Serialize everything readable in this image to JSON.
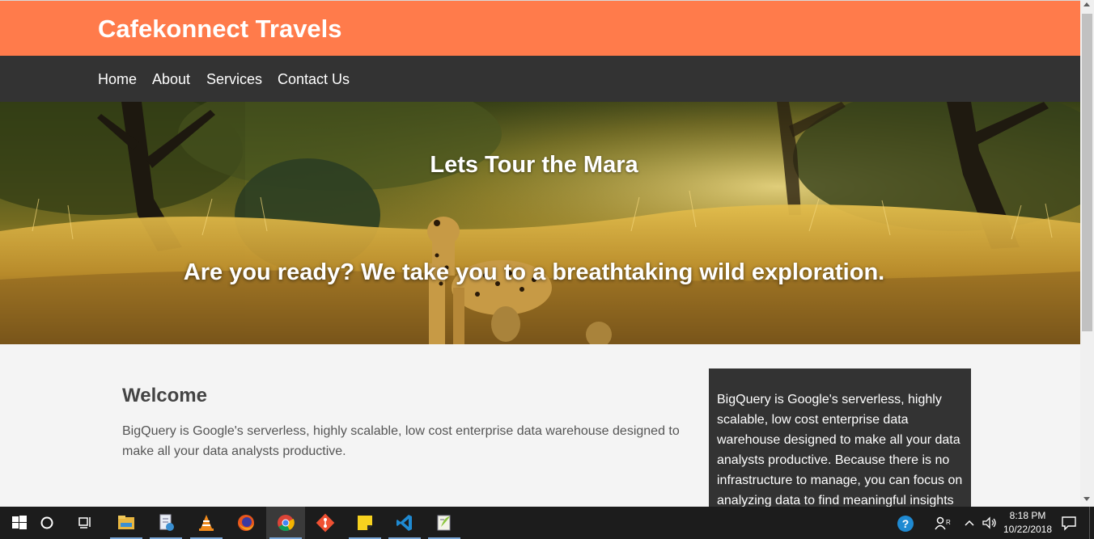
{
  "site": {
    "brand": "Cafekonnect Travels",
    "nav": [
      "Home",
      "About",
      "Services",
      "Contact Us"
    ]
  },
  "hero": {
    "title": "Lets Tour the Mara",
    "subtitle": "Are you ready? We take you to a breathtaking wild exploration."
  },
  "welcome": {
    "title": "Welcome",
    "text": "BigQuery is Google's serverless, highly scalable, low cost enterprise data warehouse designed to make all your data analysts productive."
  },
  "sidebox": {
    "text": "BigQuery is Google's serverless, highly scalable, low cost enterprise data warehouse designed to make all your data analysts productive. Because there is no infrastructure to manage, you can focus on analyzing data to find meaningful insights"
  },
  "taskbar": {
    "apps": [
      "start-icon",
      "cortana-icon",
      "task-view-icon",
      "file-explorer-icon",
      "notepad-icon",
      "vlc-icon",
      "firefox-icon",
      "chrome-icon",
      "git-icon",
      "sticky-notes-icon",
      "vscode-icon",
      "notepad-plus-plus-icon"
    ],
    "active_app": "chrome-icon",
    "clock_time": "8:18 PM",
    "clock_date": "10/22/2018"
  },
  "colors": {
    "header": "#ff7b4b",
    "nav": "#333333",
    "sidebox": "#333333",
    "page_bg": "#f4f4f4"
  }
}
